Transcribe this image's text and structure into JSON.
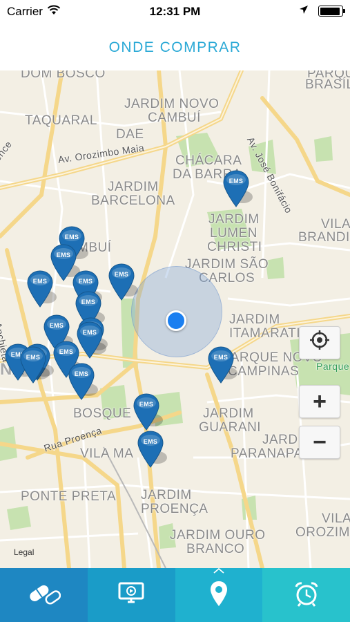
{
  "status": {
    "carrier": "Carrier",
    "time": "12:31 PM"
  },
  "header": {
    "title": "ONDE COMPRAR"
  },
  "map": {
    "labels": [
      {
        "text": "DOM BOSCO"
      },
      {
        "text": "PARQUE"
      },
      {
        "text": "BRASÍL"
      },
      {
        "text": "JARDIM NOVO"
      },
      {
        "text": "CAMBUÍ"
      },
      {
        "text": "TAQUARAL"
      },
      {
        "text": "DAE"
      },
      {
        "text": "CHÁCARA"
      },
      {
        "text": "DA BARRA"
      },
      {
        "text": "JARDIM"
      },
      {
        "text": "BARCELONA"
      },
      {
        "text": "JARDIM"
      },
      {
        "text": "LUMEN"
      },
      {
        "text": "CHRISTI"
      },
      {
        "text": "VILA"
      },
      {
        "text": "BRANDI"
      },
      {
        "text": "MBUÍ"
      },
      {
        "text": "JARDIM SÃO"
      },
      {
        "text": "CARLOS"
      },
      {
        "text": "JARDIM"
      },
      {
        "text": "ITAMARATI"
      },
      {
        "text": "PARQUE NOVO"
      },
      {
        "text": "CAMPINAS"
      },
      {
        "text": "BOSQUE"
      },
      {
        "text": "JARDIM"
      },
      {
        "text": "GUARANI"
      },
      {
        "text": "JARD"
      },
      {
        "text": "PARANAPA"
      },
      {
        "text": "VILA MA"
      },
      {
        "text": "PONTE PRETA"
      },
      {
        "text": "JARDIM"
      },
      {
        "text": "PROENÇA"
      },
      {
        "text": "JARDIM OURO"
      },
      {
        "text": "BRANCO"
      },
      {
        "text": "VILA"
      },
      {
        "text": "OROZIM"
      }
    ],
    "streets": [
      {
        "text": "Av. Orozimbo Maia"
      },
      {
        "text": "Av. José Bonifácio"
      },
      {
        "text": "Av. Anchieta"
      },
      {
        "text": "Rua Proença"
      },
      {
        "text": "ence"
      }
    ],
    "park_label": "Parque Emílio",
    "cutoff_label": "NA",
    "pin_label": "EMS",
    "pin_count": 18,
    "legal": "Legal",
    "controls": {
      "locate_icon": "crosshair-icon",
      "zoom_in": "+",
      "zoom_out": "−"
    }
  },
  "tabs": [
    {
      "icon": "pills-icon",
      "color": "#1e87c2"
    },
    {
      "icon": "monitor-play-icon",
      "color": "#1a9cc8"
    },
    {
      "icon": "map-pin-icon",
      "color": "#1fb1cf"
    },
    {
      "icon": "alarm-clock-icon",
      "color": "#28c2cc"
    }
  ],
  "colors": {
    "accent": "#2aa9d6",
    "pin": "#1d6fb5",
    "user_location": "#1b7ff0"
  }
}
